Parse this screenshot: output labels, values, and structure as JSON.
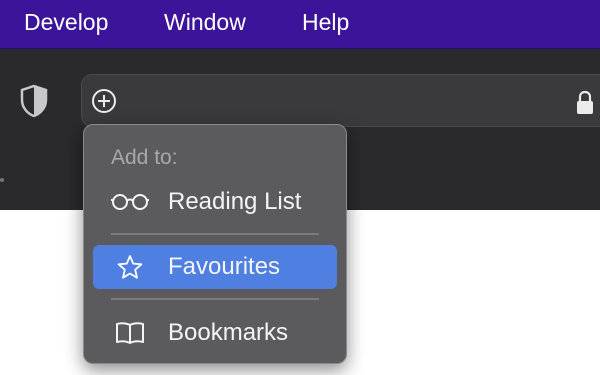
{
  "menubar": {
    "items": [
      "Develop",
      "Window",
      "Help"
    ]
  },
  "toolbar": {
    "privacy_icon": "shield-icon",
    "add_icon": "plus-circle-icon",
    "lock_icon": "lock-icon"
  },
  "popup": {
    "header": "Add to:",
    "items": [
      {
        "label": "Reading List",
        "icon": "glasses-icon",
        "selected": false
      },
      {
        "label": "Favourites",
        "icon": "star-icon",
        "selected": true
      },
      {
        "label": "Bookmarks",
        "icon": "book-icon",
        "selected": false
      }
    ]
  },
  "colors": {
    "menubar": "#3c1499",
    "toolbar": "#2a292b",
    "popup": "#5b5a5d",
    "selection": "#4f7fe0"
  }
}
